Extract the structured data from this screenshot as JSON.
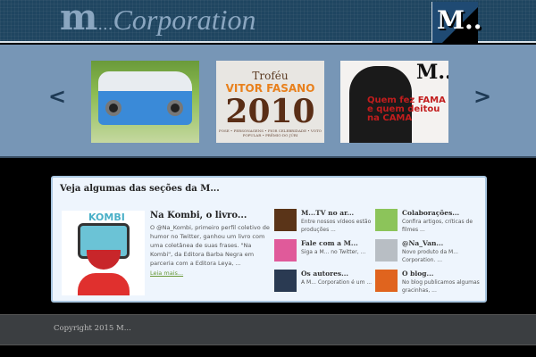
{
  "header": {
    "logo_m": "m",
    "logo_dots": "...",
    "logo_corp": "Corporation",
    "badge": "M.."
  },
  "carousel": {
    "prev": "<",
    "next": ">",
    "slides": [
      {
        "name": "kombi-photo"
      },
      {
        "name": "trofeu",
        "line1": "Troféu",
        "line2": "VITOR FASANO",
        "line3": "2010",
        "line4": "POSE • PERSONAGENS • PIOR CELEBRIDADE • VOTO POPULAR • PRÊMIO DO JÚRI"
      },
      {
        "name": "revista",
        "cover": "M..",
        "headline": "Quem fez FAMA e quem deitou na CAMA"
      }
    ]
  },
  "sections": {
    "heading": "Veja algumas das seções da M...",
    "featured": {
      "img_label": "KOMBI",
      "title": "Na Kombi, o livro...",
      "text": "O @Na_Kombi, primeiro perfil coletivo de humor no Twitter, ganhou um livro com uma coletânea de suas frases. \"Na Kombi\", da Editora Barba Negra em parceria com a Editora Leya, ...",
      "more": "Leia mais..."
    },
    "items": [
      {
        "title": "M...TV no ar...",
        "text": "Entre nossos vídeos estão produções ...",
        "color": "#5a3418"
      },
      {
        "title": "Colaborações...",
        "text": "Confira artigos, críticas de filmes ...",
        "color": "#8cc45a"
      },
      {
        "title": "Fale com a M...",
        "text": "Siga a M... no Twitter, ...",
        "color": "#e05a9a"
      },
      {
        "title": "@Na_Van...",
        "text": "Novo produto da M... Corporation. ...",
        "color": "#b8bec4"
      },
      {
        "title": "Os autores...",
        "text": "A M... Corporation é um ...",
        "color": "#2a3a52"
      },
      {
        "title": "O blog...",
        "text": "No blog publicamos algumas gracinhas, ...",
        "color": "#e0641e"
      }
    ]
  },
  "footer": {
    "copyright": "Copyright 2015 M..."
  }
}
